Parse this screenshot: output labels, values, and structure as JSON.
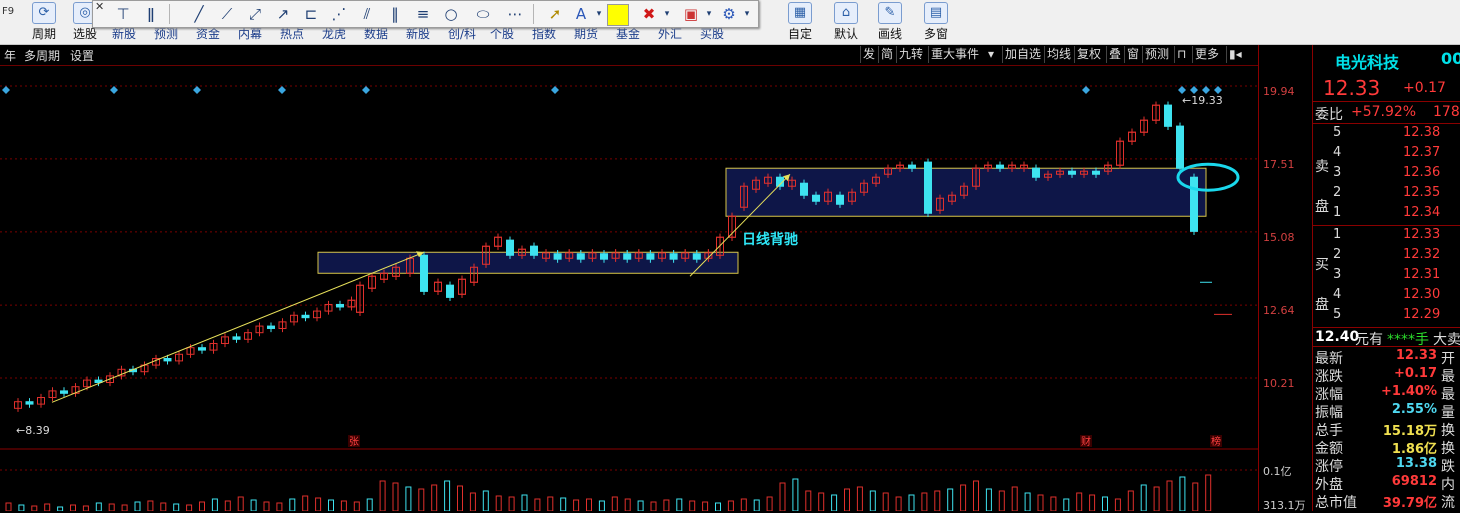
{
  "toolbar": {
    "left_items": [
      {
        "icon": "F9",
        "label": "F9"
      },
      {
        "icon": "周",
        "label": "周期"
      },
      {
        "icon": "选",
        "label": "选股"
      }
    ],
    "right_items": [
      {
        "icon": "自",
        "label": "自定"
      },
      {
        "icon": "默",
        "label": "默认"
      },
      {
        "icon": "画",
        "label": "画线"
      },
      {
        "icon": "多",
        "label": "多窗"
      }
    ],
    "row_links": [
      "新股",
      "预测",
      "资金",
      "内幕",
      "热点",
      "龙虎",
      "数据",
      "新股",
      "创/科",
      "个股",
      "指数",
      "期货",
      "基金",
      "外汇",
      "买股"
    ]
  },
  "drawing_tools": [
    "chart-type",
    "cursor",
    "text",
    "color",
    "delete",
    "style",
    "settings"
  ],
  "subbar": {
    "left": [
      "年",
      "多周期",
      "设置"
    ],
    "right": [
      "发",
      "简",
      "九转",
      "重大事件",
      "加自选",
      "均线",
      "复权",
      "叠",
      "窗",
      "预测",
      "更多"
    ]
  },
  "chart": {
    "annotation": "日线背驰",
    "high_label": "19.33",
    "low_label": "8.39",
    "price_ticks": [
      "19.94",
      "17.51",
      "15.08",
      "12.64",
      "10.21"
    ],
    "markers": [
      "张",
      "财",
      "榜"
    ],
    "volume_ticks": [
      "0.1亿",
      "313.1万"
    ]
  },
  "quote": {
    "name": "电光科技",
    "code": "00",
    "price": "12.33",
    "change": "+0.17",
    "weibi_label": "委比",
    "weibi_value": "+57.92%",
    "weibi_extra": "178",
    "sell_label": "卖盘",
    "buy_label": "买盘",
    "sell": [
      {
        "level": "5",
        "price": "12.38"
      },
      {
        "level": "4",
        "price": "12.37"
      },
      {
        "level": "3",
        "price": "12.36"
      },
      {
        "level": "2",
        "price": "12.35"
      },
      {
        "level": "1",
        "price": "12.34"
      }
    ],
    "buy": [
      {
        "level": "1",
        "price": "12.33"
      },
      {
        "level": "2",
        "price": "12.32"
      },
      {
        "level": "3",
        "price": "12.31"
      },
      {
        "level": "4",
        "price": "12.30"
      },
      {
        "level": "5",
        "price": "12.29"
      }
    ],
    "trade_line": {
      "price": "12.40",
      "unit": "元有",
      "hand": "****手",
      "tail": "大卖"
    },
    "stats": [
      {
        "k": "最新",
        "v": "12.33",
        "x": "开"
      },
      {
        "k": "涨跌",
        "v": "+0.17",
        "x": "最"
      },
      {
        "k": "涨幅",
        "v": "+1.40%",
        "x": "最"
      },
      {
        "k": "振幅",
        "v": "2.55%",
        "x": "量"
      },
      {
        "k": "总手",
        "v": "15.18万",
        "x": "换"
      },
      {
        "k": "金额",
        "v": "1.86亿",
        "x": "换"
      },
      {
        "k": "涨停",
        "v": "13.38",
        "x": "跌"
      },
      {
        "k": "外盘",
        "v": "69812",
        "x": "内"
      },
      {
        "k": "总市值",
        "v": "39.79亿",
        "x": "流"
      }
    ]
  },
  "colors": {
    "up": "#e0302c",
    "down": "#3ee3f0",
    "box": "#101a55",
    "box_edge": "#d8c64a",
    "grid": "#7a0000",
    "arrow": "#e7e05a"
  }
}
